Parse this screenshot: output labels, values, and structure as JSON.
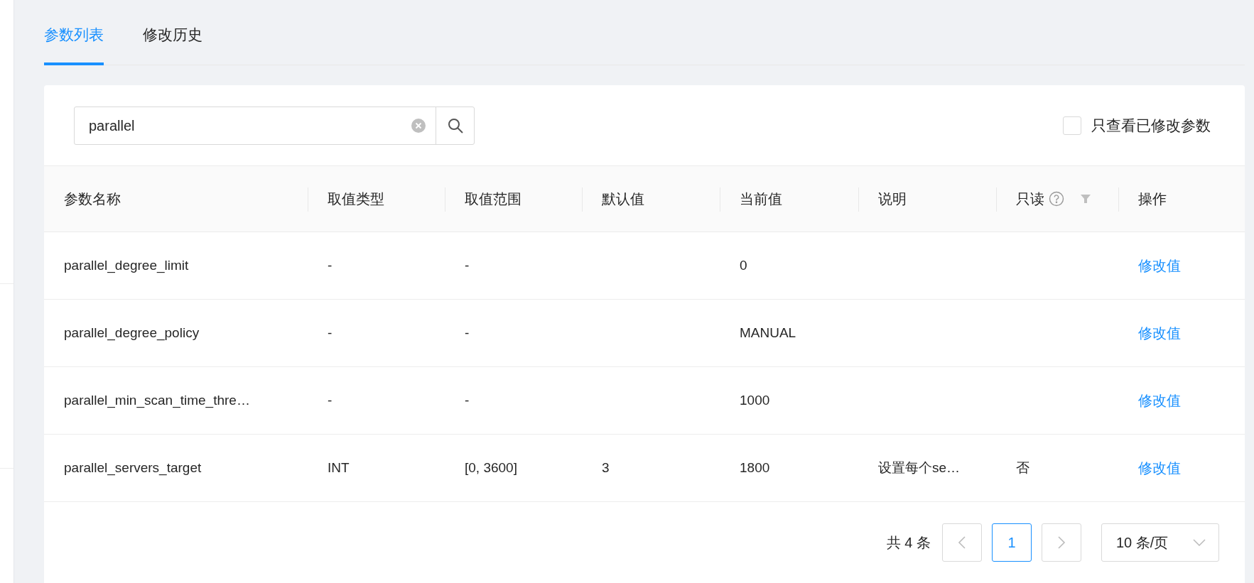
{
  "tabs": [
    {
      "label": "参数列表",
      "selected": true
    },
    {
      "label": "修改历史",
      "selected": false
    }
  ],
  "search": {
    "value": "parallel"
  },
  "modified_only": {
    "label": "只查看已修改参数",
    "checked": false
  },
  "table": {
    "columns": [
      {
        "label": "参数名称"
      },
      {
        "label": "取值类型"
      },
      {
        "label": "取值范围"
      },
      {
        "label": "默认值"
      },
      {
        "label": "当前值"
      },
      {
        "label": "说明"
      },
      {
        "label": "只读",
        "help": true,
        "filter": true
      },
      {
        "label": "操作"
      }
    ],
    "rows": [
      {
        "name": "parallel_degree_limit",
        "type": "-",
        "range": "-",
        "current": "0",
        "action": "修改值"
      },
      {
        "name": "parallel_degree_policy",
        "type": "-",
        "range": "-",
        "current": "MANUAL",
        "action": "修改值"
      },
      {
        "name": "parallel_min_scan_time_thre…",
        "type": "-",
        "range": "-",
        "current": "1000",
        "action": "修改值"
      },
      {
        "name": "parallel_servers_target",
        "type": "INT",
        "range": "[0, 3600]",
        "default": "3",
        "current": "1800",
        "description": "设置每个se…",
        "readonly": "否",
        "action": "修改值"
      }
    ]
  },
  "pagination": {
    "total": "共 4 条",
    "pages": [
      {
        "label": "1",
        "selected": true
      }
    ],
    "page_size": "10 条/页"
  }
}
